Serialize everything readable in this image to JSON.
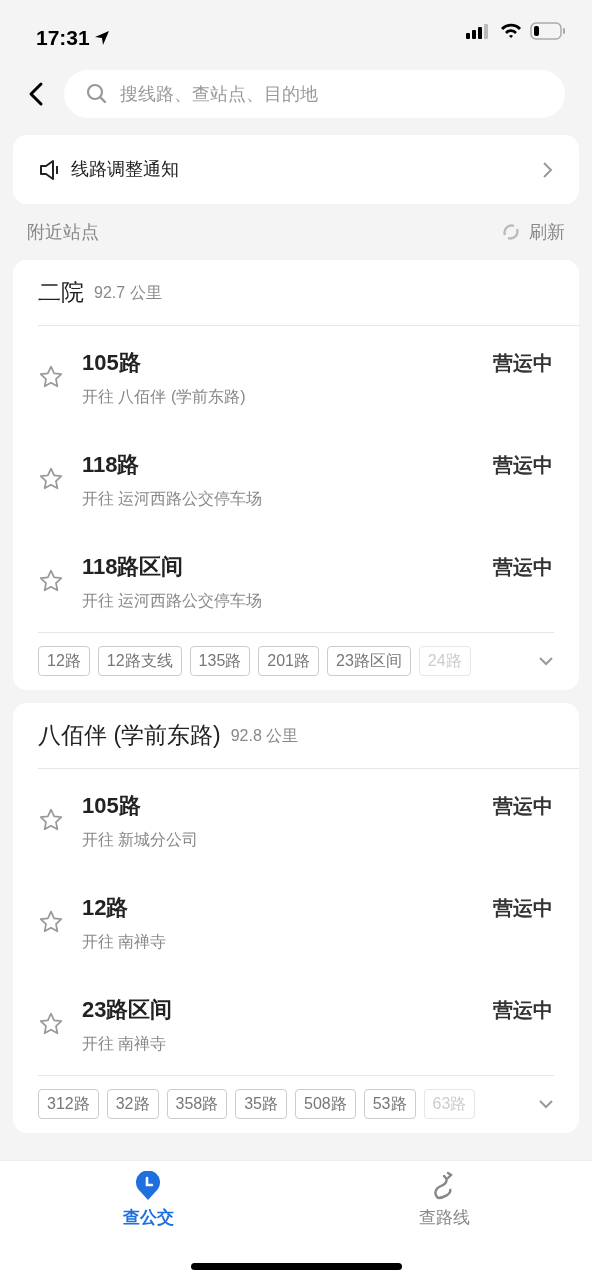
{
  "status_bar": {
    "time": "17:31"
  },
  "search": {
    "placeholder": "搜线路、查站点、目的地"
  },
  "notice": {
    "text": "线路调整通知"
  },
  "section": {
    "title": "附近站点",
    "action": "刷新"
  },
  "stations": [
    {
      "name": "二院",
      "distance": "92.7 公里",
      "routes": [
        {
          "name": "105路",
          "direction": "开往 八佰伴 (学前东路)",
          "status": "营运中",
          "favorite": false
        },
        {
          "name": "118路",
          "direction": "开往 运河西路公交停车场",
          "status": "营运中",
          "favorite": false
        },
        {
          "name": "118路区间",
          "direction": "开往 运河西路公交停车场",
          "status": "营运中",
          "favorite": false
        }
      ],
      "tags": [
        {
          "label": "12路",
          "faded": false
        },
        {
          "label": "12路支线",
          "faded": false
        },
        {
          "label": "135路",
          "faded": false
        },
        {
          "label": "201路",
          "faded": false
        },
        {
          "label": "23路区间",
          "faded": false
        },
        {
          "label": "24路",
          "faded": true
        }
      ]
    },
    {
      "name": "八佰伴 (学前东路)",
      "distance": "92.8 公里",
      "routes": [
        {
          "name": "105路",
          "direction": "开往 新城分公司",
          "status": "营运中",
          "favorite": false
        },
        {
          "name": "12路",
          "direction": "开往 南禅寺",
          "status": "营运中",
          "favorite": false
        },
        {
          "name": "23路区间",
          "direction": "开往 南禅寺",
          "status": "营运中",
          "favorite": false
        }
      ],
      "tags": [
        {
          "label": "312路",
          "faded": false
        },
        {
          "label": "32路",
          "faded": false
        },
        {
          "label": "358路",
          "faded": false
        },
        {
          "label": "35路",
          "faded": false
        },
        {
          "label": "508路",
          "faded": false
        },
        {
          "label": "53路",
          "faded": false
        },
        {
          "label": "63路",
          "faded": true
        }
      ]
    }
  ],
  "tabs": [
    {
      "label": "查公交",
      "kind": "bus",
      "selected": true
    },
    {
      "label": "查路线",
      "kind": "route",
      "selected": false
    }
  ]
}
